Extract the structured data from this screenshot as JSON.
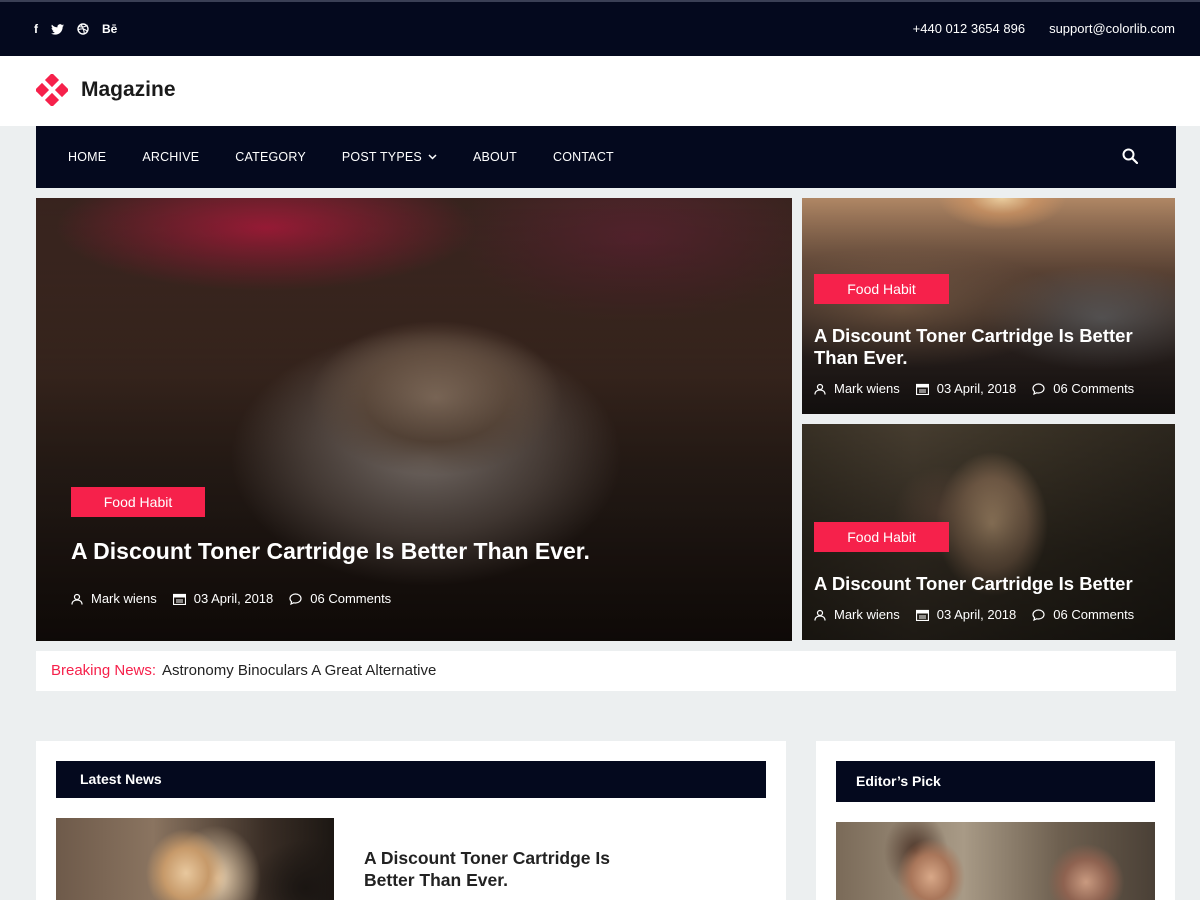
{
  "topbar": {
    "social": [
      {
        "icon": "facebook-icon",
        "glyph": "f"
      },
      {
        "icon": "twitter-icon",
        "glyph": ""
      },
      {
        "icon": "dribbble-icon",
        "glyph": ""
      },
      {
        "icon": "behance-icon",
        "glyph": "Bē"
      }
    ],
    "phone": "+440 012 3654 896",
    "email": "support@colorlib.com"
  },
  "brand": {
    "name": "Magazine",
    "accent": "#f6214b",
    "dark": "#04091e"
  },
  "nav": {
    "items": [
      "HOME",
      "ARCHIVE",
      "CATEGORY",
      "POST TYPES",
      "ABOUT",
      "CONTACT"
    ]
  },
  "hero": {
    "main": {
      "badge": "Food Habit",
      "title": "A Discount Toner Cartridge Is Better Than Ever.",
      "author": "Mark wiens",
      "date": "03 April, 2018",
      "comments": "06 Comments"
    },
    "side_top": {
      "badge": "Food Habit",
      "title": "A Discount Toner Cartridge Is Better Than Ever.",
      "author": "Mark wiens",
      "date": "03 April, 2018",
      "comments": "06 Comments"
    },
    "side_bottom": {
      "badge": "Food Habit",
      "title": "A Discount Toner Cartridge Is Better",
      "author": "Mark wiens",
      "date": "03 April, 2018",
      "comments": "06 Comments"
    }
  },
  "breaking": {
    "label": "Breaking News:",
    "text": "Astronomy Binoculars A Great Alternative"
  },
  "latest": {
    "heading": "Latest News",
    "first_title": "A Discount Toner Cartridge Is Better Than Ever."
  },
  "editors_pick": {
    "heading": "Editor’s Pick"
  }
}
